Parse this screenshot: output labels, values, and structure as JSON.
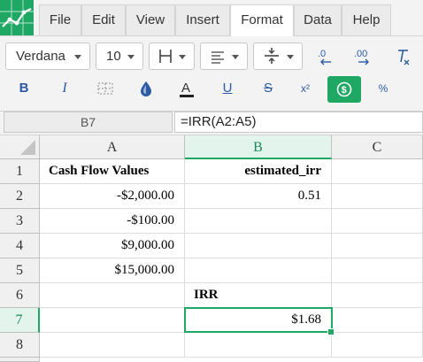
{
  "menu": {
    "items": [
      "File",
      "Edit",
      "View",
      "Insert",
      "Format",
      "Data",
      "Help"
    ],
    "active": "Format"
  },
  "toolbar": {
    "font_family": "Verdana",
    "font_size": "10",
    "bold_label": "B",
    "italic_label": "I",
    "underline_label": "U",
    "strike_label": "S",
    "superscript_label": "x²",
    "percent_label": "%",
    "icons": [
      "borders-icon",
      "align-left-icon",
      "vertical-align-icon",
      "decrease-decimal-icon",
      "increase-decimal-icon",
      "clear-format-icon",
      "merge-cells-icon",
      "fill-color-icon",
      "text-color-icon",
      "currency-icon"
    ],
    "accent_color": "#1fa864"
  },
  "formula_bar": {
    "cell_ref": "B7",
    "formula": "=IRR(A2:A5)"
  },
  "sheet": {
    "columns": [
      "A",
      "B",
      "C"
    ],
    "selected_column": "B",
    "rows": [
      {
        "n": "1",
        "a": "Cash Flow Values",
        "b": "estimated_irr"
      },
      {
        "n": "2",
        "a": "-$2,000.00",
        "b": "0.51"
      },
      {
        "n": "3",
        "a": "-$100.00",
        "b": ""
      },
      {
        "n": "4",
        "a": "$9,000.00",
        "b": ""
      },
      {
        "n": "5",
        "a": "$15,000.00",
        "b": ""
      },
      {
        "n": "6",
        "a": "",
        "b": "IRR"
      },
      {
        "n": "7",
        "a": "",
        "b": "$1.68"
      },
      {
        "n": "8",
        "a": "",
        "b": ""
      }
    ],
    "selected_row": "7"
  }
}
